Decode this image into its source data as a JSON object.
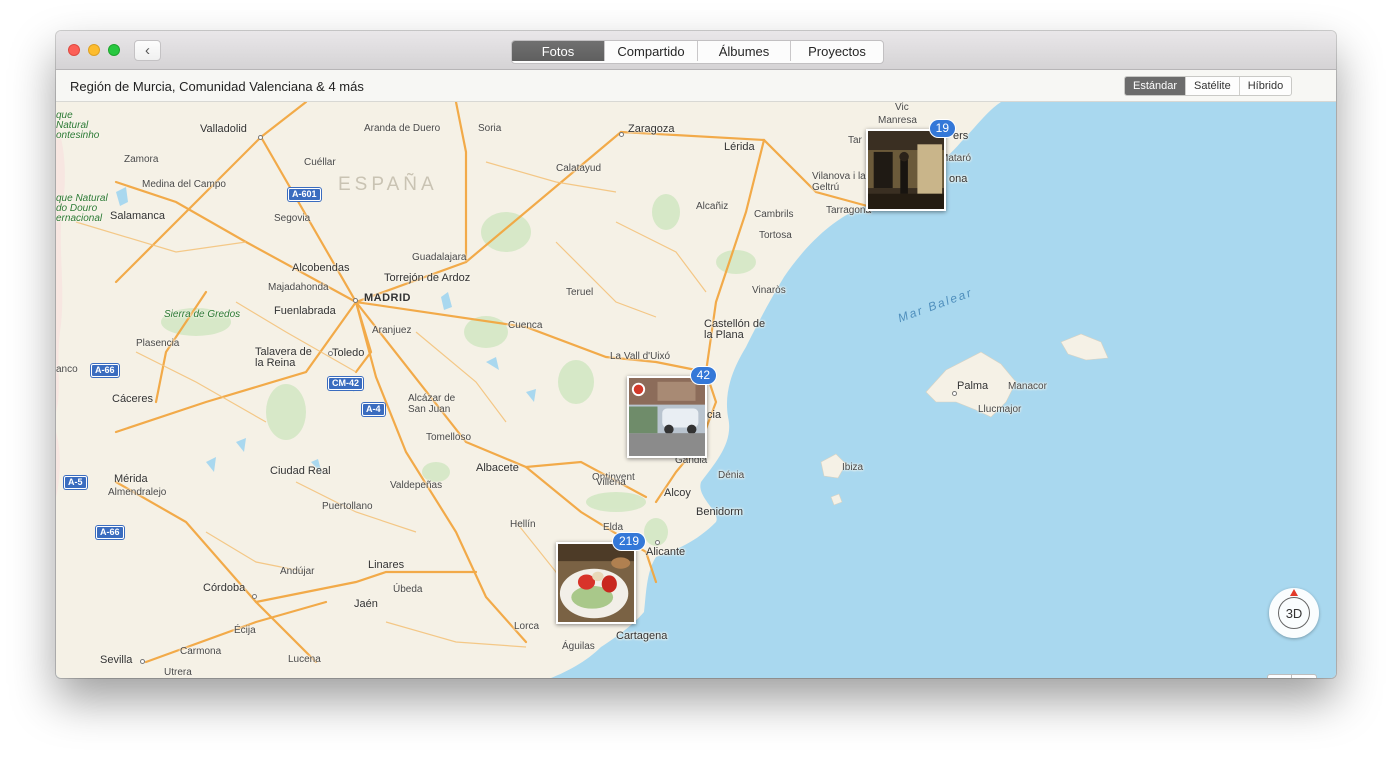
{
  "window": {
    "tabs": [
      {
        "label": "Fotos",
        "active": true
      },
      {
        "label": "Compartido",
        "active": false
      },
      {
        "label": "Álbumes",
        "active": false
      },
      {
        "label": "Proyectos",
        "active": false
      }
    ]
  },
  "infobar": {
    "location_title": "Región de Murcia, Comunidad Valenciana & 4 más",
    "map_types": [
      {
        "label": "Estándar",
        "active": true
      },
      {
        "label": "Satélite",
        "active": false
      },
      {
        "label": "Híbrido",
        "active": false
      }
    ]
  },
  "map": {
    "country_label": "ESPAÑA",
    "capital_label": "MADRID",
    "sea_label": "Mar Balear",
    "parks": [
      "Sierra de Gredos",
      "que Natural ontesinho",
      "que Natural do Douro ernacional"
    ],
    "cities": [
      "Valladolid",
      "Aranda de Duero",
      "Soria",
      "Zaragoza",
      "Lérida",
      "Manresa",
      "Vic",
      "Zamora",
      "Cuéllar",
      "Calatayud",
      "Medina del Campo",
      "Vilanova i la Geltrú",
      "Mataró",
      "Salamanca",
      "Segovia",
      "Alcañiz",
      "Cambrils",
      "Tarragona",
      "Tortosa",
      "Guadalajara",
      "Alcobendas",
      "Torrejón de Ardoz",
      "Majadahonda",
      "Fuenlabrada",
      "Vinaròs",
      "Teruel",
      "Aranjuez",
      "Cuenca",
      "Castellón de la Plana",
      "Plasencia",
      "Talavera de la Reina",
      "Toledo",
      "La Vall d'Uixó",
      "Palma",
      "Manacor",
      "Llucmajor",
      "Cáceres",
      "Alcázar de San Juan",
      "Tomelloso",
      "Ciudad Real",
      "Albacete",
      "Ibiza",
      "Gandia",
      "Dénia",
      "Ontinyent",
      "Alcoy",
      "Mérida",
      "Almendralejo",
      "Valdepeñas",
      "Puertollano",
      "Villena",
      "Benidorm",
      "Hellín",
      "Elda",
      "Alicante",
      "Andújar",
      "Linares",
      "Úbeda",
      "Córdoba",
      "Jaén",
      "Écija",
      "Lorca",
      "Cartagena",
      "Águilas",
      "Sevilla",
      "Carmona",
      "Lucena",
      "Utrera",
      "anco",
      "Tar",
      "ona",
      "ers",
      "cia"
    ],
    "roads": [
      "A-601",
      "CM-42",
      "A-4",
      "A-66",
      "A-5",
      "A-66"
    ],
    "clusters": [
      {
        "count": "19",
        "place": "Barcelona"
      },
      {
        "count": "42",
        "place": "Valencia"
      },
      {
        "count": "219",
        "place": "Alicante"
      }
    ]
  },
  "controls": {
    "compass_label": "3D",
    "zoom_out": "−",
    "zoom_in": "+"
  }
}
